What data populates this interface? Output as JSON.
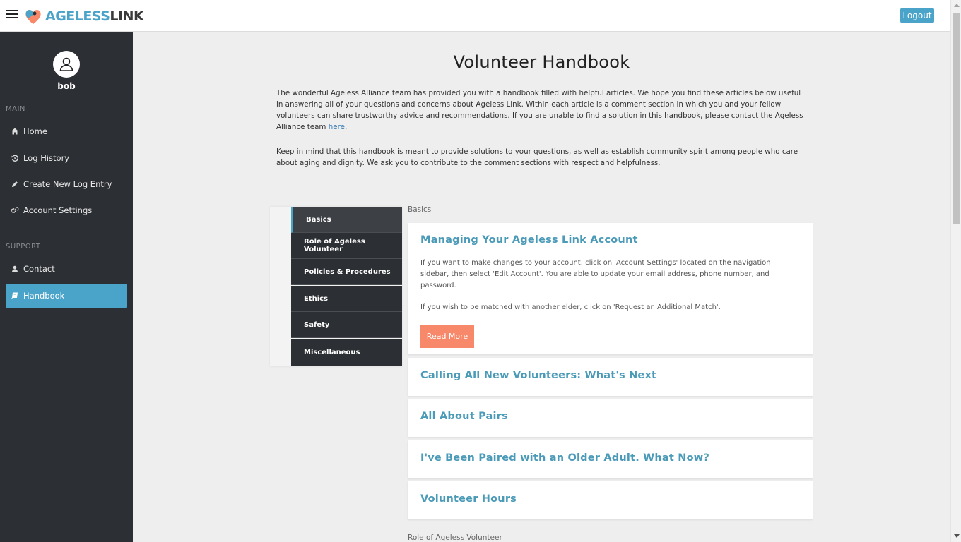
{
  "header": {
    "logo_part1": "AGELESS",
    "logo_part2": "LINK",
    "logout_label": "Logout"
  },
  "sidebar": {
    "username": "bob",
    "main_label": "MAIN",
    "support_label": "SUPPORT",
    "items": [
      {
        "label": "Home",
        "icon": "home-icon"
      },
      {
        "label": "Log History",
        "icon": "history-icon"
      },
      {
        "label": "Create New Log Entry",
        "icon": "pencil-icon"
      },
      {
        "label": "Account Settings",
        "icon": "cogs-icon"
      },
      {
        "label": "Contact",
        "icon": "user-icon"
      },
      {
        "label": "Handbook",
        "icon": "book-icon",
        "active": true
      }
    ]
  },
  "main": {
    "title": "Volunteer Handbook",
    "intro1_before": "The wonderful Ageless Alliance team has provided you with a handbook filled with helpful articles. We hope you find these articles below useful in answering all of your questions and concerns about Ageless Link. Within each article is a comment section in which you and your fellow volunteers can share trustworthy advice and recommendations. If you are unable to find a solution in this handbook, please contact the Ageless Alliance team",
    "intro1_link": "here",
    "intro1_after": ".",
    "intro2": "Keep in mind that this handbook is meant to provide solutions to your questions, as well as establish community spirit among people who care about aging and dignity. We ask you to contribute to the comment sections with respect and helpfulness.",
    "tabs": [
      "Basics",
      "Role of Ageless Volunteer",
      "Policies & Procedures",
      "Ethics",
      "Safety",
      "Miscellaneous"
    ],
    "category_label": "Basics",
    "next_category_label": "Role of Ageless Volunteer",
    "articles": [
      {
        "title": "Managing Your Ageless Link Account",
        "p1": "If you want to make changes to your account, click on 'Account Settings' located on the navigation sidebar, then select 'Edit Account'. You are able to update your email address, phone number, and password.",
        "p2": "If you wish to be matched with another elder, click on 'Request an Additional Match'.",
        "button": "Read More"
      },
      {
        "title": "Calling All New Volunteers: What's Next"
      },
      {
        "title": "All About Pairs"
      },
      {
        "title": "I've Been Paired with an Older Adult. What Now?"
      },
      {
        "title": "Volunteer Hours"
      }
    ]
  },
  "colors": {
    "accent": "#4aa3c9",
    "sidebar_bg": "#2c2f33",
    "read_more": "#f7896a",
    "article_title": "#4a9ab8"
  }
}
